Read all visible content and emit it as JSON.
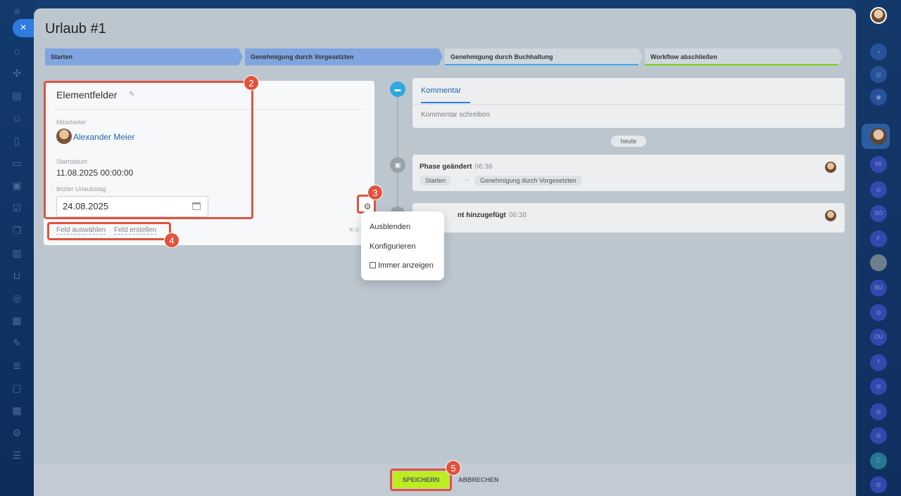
{
  "window": {
    "title": "Urlaub #1",
    "close_label": "×"
  },
  "stages": [
    {
      "label": "Starten",
      "state": "done",
      "line_color": ""
    },
    {
      "label": "Genehmigung durch Vorgesetzten",
      "state": "done",
      "line_color": ""
    },
    {
      "label": "Genehmigung durch Buchhaltung",
      "state": "todo",
      "line_color": "#39a8ef"
    },
    {
      "label": "Workflow abschließen",
      "state": "todo",
      "line_color": "#7bd500"
    }
  ],
  "card": {
    "title": "Elementfelder",
    "employee_label": "Mitarbeiter",
    "employee_name": "Alexander Meier",
    "start_label": "Startdatum",
    "start_value": "11.08.2025 00:00:00",
    "last_day_label": "letzter Urlaubstag",
    "last_day_value": "24.08.2025",
    "select_field": "Feld auswählen",
    "create_field": "Feld erstellen"
  },
  "menu": {
    "items": [
      "Ausblenden",
      "Konfigurieren"
    ],
    "checkbox_label": "Immer anzeigen",
    "checkbox_checked": false
  },
  "timeline": {
    "comment_tab": "Kommentar",
    "comment_placeholder": "Kommentar schreiben",
    "today_label": "heute",
    "events": [
      {
        "title": "Phase geändert",
        "time": "06:38",
        "from": "Starten",
        "to": "Genehmigung durch Vorgesetzten"
      },
      {
        "title": "nt hinzugefügt",
        "time": "06:38"
      }
    ]
  },
  "annotations": [
    "2",
    "3",
    "4",
    "5"
  ],
  "footer": {
    "save_label": "SPEICHERN",
    "cancel_label": "ABBRECHEN"
  },
  "colors": {
    "accent": "#2f7ce0",
    "highlight": "#e0533f",
    "save_button": "#bbed21"
  }
}
